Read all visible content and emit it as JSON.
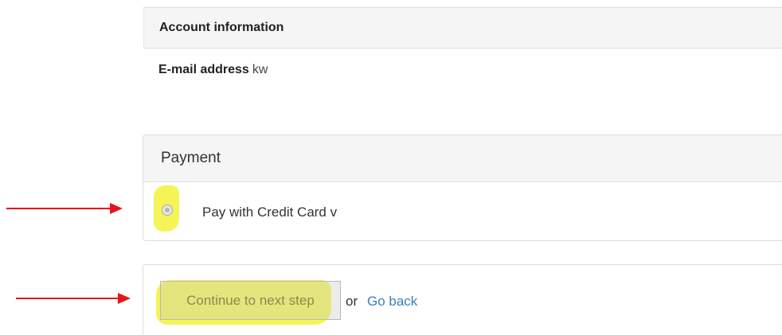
{
  "account": {
    "header": "Account information",
    "email_label": "E-mail address",
    "email_value": "kw"
  },
  "payment": {
    "heading": "Payment",
    "option_label": "Pay with Credit Card v",
    "option_selected": true
  },
  "actions": {
    "continue_label": "Continue to next step",
    "or_text": "or",
    "go_back_label": "Go back"
  },
  "annotations": {
    "arrow_color": "#e5161b",
    "highlight_color": "#f2f23a"
  }
}
